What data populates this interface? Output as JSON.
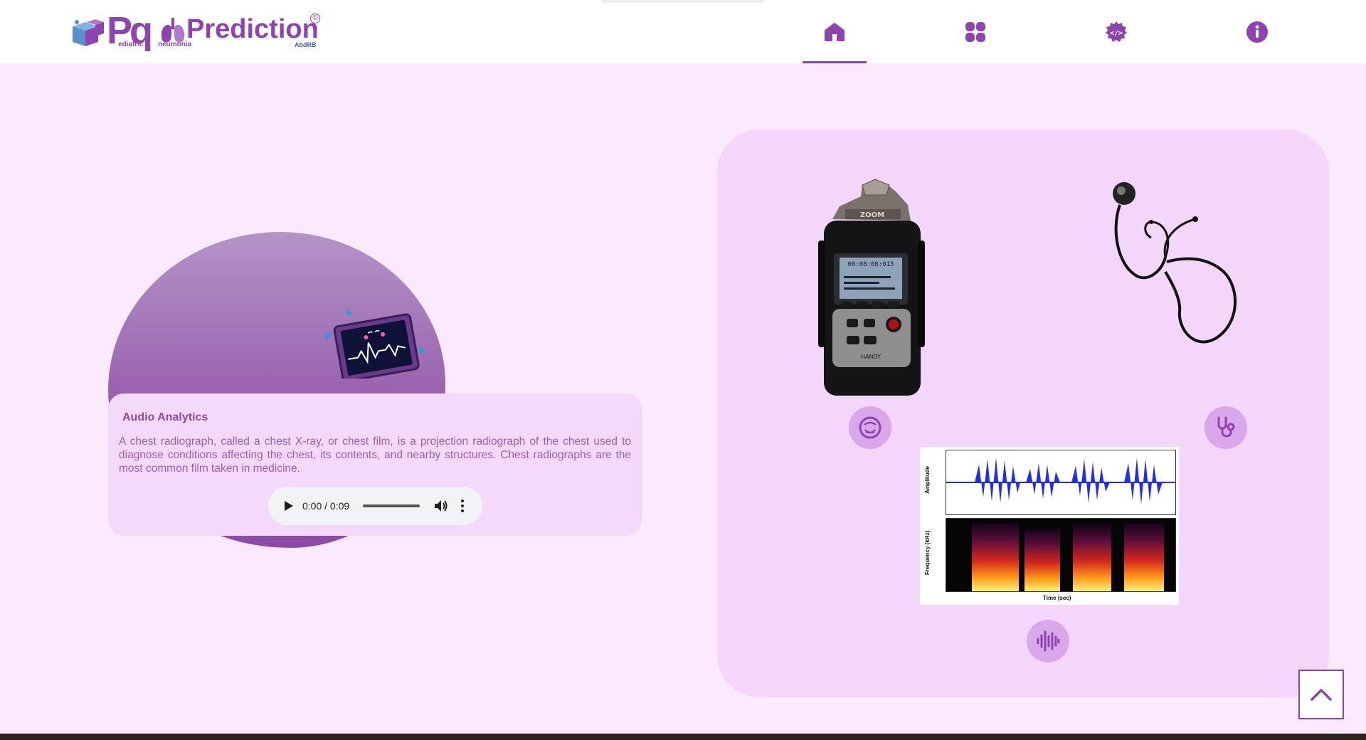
{
  "brand": {
    "logo_letters": "Pq",
    "name": "Prediction",
    "copyright_symbol": "©",
    "sub_pediatric": "ediatric",
    "sub_pneumonia": "neumonia",
    "author": "AbdRB"
  },
  "nav": {
    "items": [
      {
        "icon": "home-icon",
        "active": true
      },
      {
        "icon": "grid-icon",
        "active": false
      },
      {
        "icon": "code-gear-icon",
        "active": false
      },
      {
        "icon": "info-icon",
        "active": false
      }
    ]
  },
  "card": {
    "title": "Audio Analytics",
    "text": "A chest radiograph, called a chest X-ray, or chest film, is a projection radiograph of the chest used to diagnose conditions affecting the chest, its contents, and nearby structures. Chest radiographs are the most common film taken in medicine."
  },
  "audio_player": {
    "time": "0:00 / 0:09"
  },
  "spectrogram": {
    "amp_label": "Amplitude",
    "freq_label": "Frequency (kHz)",
    "time_label": "Time (sec)"
  },
  "colors": {
    "accent": "#8e44b0",
    "background": "#fbeafd",
    "panel": "#f3d6fa",
    "icon_circle": "#d9a8ea"
  }
}
